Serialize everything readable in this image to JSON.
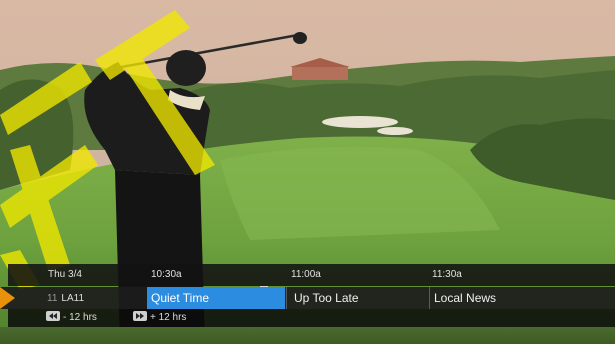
{
  "guide": {
    "date": "Thu 3/4",
    "times": [
      "10:30a",
      "11:00a",
      "11:30a"
    ],
    "channel": {
      "number": "11",
      "name": "LA11"
    },
    "programs": [
      {
        "title": "Quiet Time",
        "selected": true
      },
      {
        "title": "Up Too Late",
        "selected": false
      },
      {
        "title": "Local News",
        "selected": false
      }
    ],
    "skip_back": "- 12 hrs",
    "skip_forward": "+ 12 hrs"
  },
  "colors": {
    "selection": "#2b8ce0",
    "channel_arrow": "#e8920c",
    "watermark": "#f0e800"
  },
  "icons": [
    "rewind-key-icon",
    "fast-forward-key-icon"
  ]
}
